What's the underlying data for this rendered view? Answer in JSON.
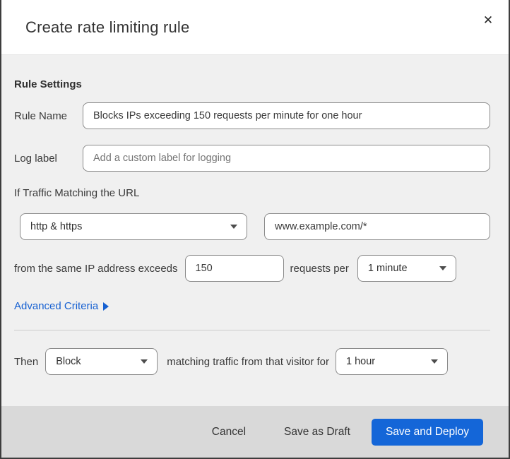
{
  "modal": {
    "title": "Create rate limiting rule",
    "close_glyph": "✕"
  },
  "form": {
    "section_heading": "Rule Settings",
    "rule_name": {
      "label": "Rule Name",
      "value": "Blocks IPs exceeding 150 requests per minute for one hour"
    },
    "log_label": {
      "label": "Log label",
      "placeholder": "Add a custom label for logging"
    },
    "traffic_match": {
      "heading": "If Traffic Matching the URL",
      "scheme_selected": "http & https",
      "url_value": "www.example.com/*"
    },
    "threshold": {
      "prefix": "from the same IP address exceeds",
      "requests_value": "150",
      "middle": "requests per",
      "period_selected": "1 minute"
    },
    "advanced_criteria_label": "Advanced Criteria",
    "action": {
      "prefix": "Then",
      "action_selected": "Block",
      "middle": "matching traffic from that visitor for",
      "duration_selected": "1 hour"
    }
  },
  "footer": {
    "cancel_label": "Cancel",
    "save_draft_label": "Save as Draft",
    "save_deploy_label": "Save and Deploy"
  },
  "colors": {
    "primary_blue": "#1466d8",
    "link_blue": "#1660d1",
    "body_bg": "#f0f0f0",
    "footer_bg": "#d9d9d9",
    "top_fragment_navy": "#17294b"
  }
}
